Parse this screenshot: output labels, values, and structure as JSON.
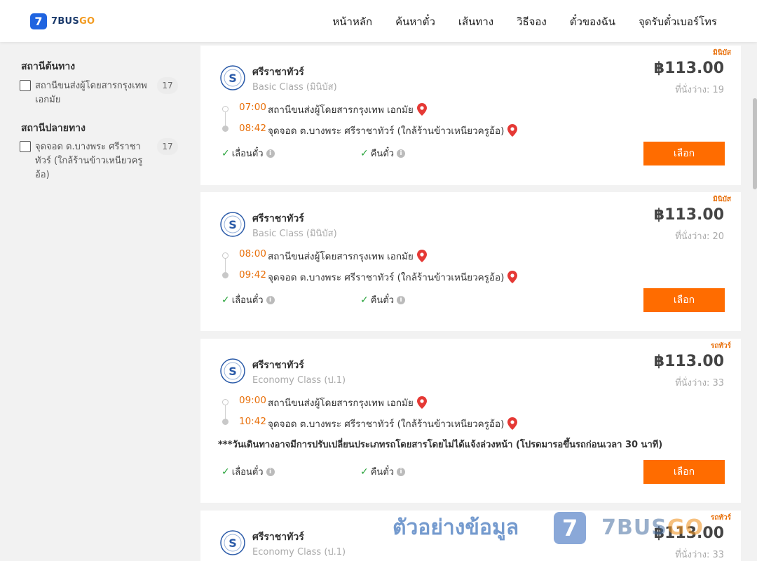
{
  "header": {
    "logo_badge": "7",
    "logo_text_main": "7BUS",
    "logo_text_accent": "GO",
    "nav": [
      "หน้าหลัก",
      "ค้นหาตั๋ว",
      "เส้นทาง",
      "วิธีจอง",
      "ตั๋วของฉัน",
      "จุดรับตั๋วเบอร์โทร"
    ]
  },
  "sidebar": {
    "origin_title": "สถานีต้นทาง",
    "origin_items": [
      {
        "label": "สถานีขนส่งผู้โดยสารกรุงเทพ เอกมัย",
        "count": "17"
      }
    ],
    "destination_title": "สถานีปลายทาง",
    "destination_items": [
      {
        "label": "จุดจอด ต.บางพระ ศรีราชาทัวร์ (ใกล้ร้านข้าวเหนียวครูอ้อ)",
        "count": "17"
      }
    ]
  },
  "trips": [
    {
      "tag": "มินิบัส",
      "operator": "ศรีราชาทัวร์",
      "class": "Basic Class (มินิบัส)",
      "price": "฿113.00",
      "seats": "ที่นั่งว่าง: 19",
      "depart_time": "07:00",
      "depart_stop": "สถานีขนส่งผู้โดยสารกรุงเทพ เอกมัย",
      "arrive_time": "08:42",
      "arrive_stop": "จุดจอด ต.บางพระ ศรีราชาทัวร์ (ใกล้ร้านข้าวเหนียวครูอ้อ)",
      "feat1": "เลื่อนตั๋ว",
      "feat2": "คืนตั๋ว",
      "button": "เลือก",
      "note": ""
    },
    {
      "tag": "มินิบัส",
      "operator": "ศรีราชาทัวร์",
      "class": "Basic Class (มินิบัส)",
      "price": "฿113.00",
      "seats": "ที่นั่งว่าง: 20",
      "depart_time": "08:00",
      "depart_stop": "สถานีขนส่งผู้โดยสารกรุงเทพ เอกมัย",
      "arrive_time": "09:42",
      "arrive_stop": "จุดจอด ต.บางพระ ศรีราชาทัวร์ (ใกล้ร้านข้าวเหนียวครูอ้อ)",
      "feat1": "เลื่อนตั๋ว",
      "feat2": "คืนตั๋ว",
      "button": "เลือก",
      "note": ""
    },
    {
      "tag": "รถทัวร์",
      "operator": "ศรีราชาทัวร์",
      "class": "Economy Class (ป.1)",
      "price": "฿113.00",
      "seats": "ที่นั่งว่าง: 33",
      "depart_time": "09:00",
      "depart_stop": "สถานีขนส่งผู้โดยสารกรุงเทพ เอกมัย",
      "arrive_time": "10:42",
      "arrive_stop": "จุดจอด ต.บางพระ ศรีราชาทัวร์ (ใกล้ร้านข้าวเหนียวครูอ้อ)",
      "feat1": "เลื่อนตั๋ว",
      "feat2": "คืนตั๋ว",
      "button": "เลือก",
      "note": "***วันเดินทางอาจมีการปรับเปลี่ยนประเภทรถโดยสารโดยไม่ได้แจ้งล่วงหน้า (โปรดมารอขึ้นรถก่อนเวลา 30 นาที)"
    },
    {
      "tag": "รถทัวร์",
      "operator": "ศรีราชาทัวร์",
      "class": "Economy Class (ป.1)",
      "price": "฿113.00",
      "seats": "ที่นั่งว่าง: 33"
    }
  ],
  "watermark": {
    "text": "ตัวอย่างข้อมูล",
    "badge": "7",
    "brand_main": "7BUS",
    "brand_accent": "GO"
  },
  "colors": {
    "accent": "#ff6c00",
    "time": "#e8700b",
    "brand_blue": "#1f64e0"
  }
}
